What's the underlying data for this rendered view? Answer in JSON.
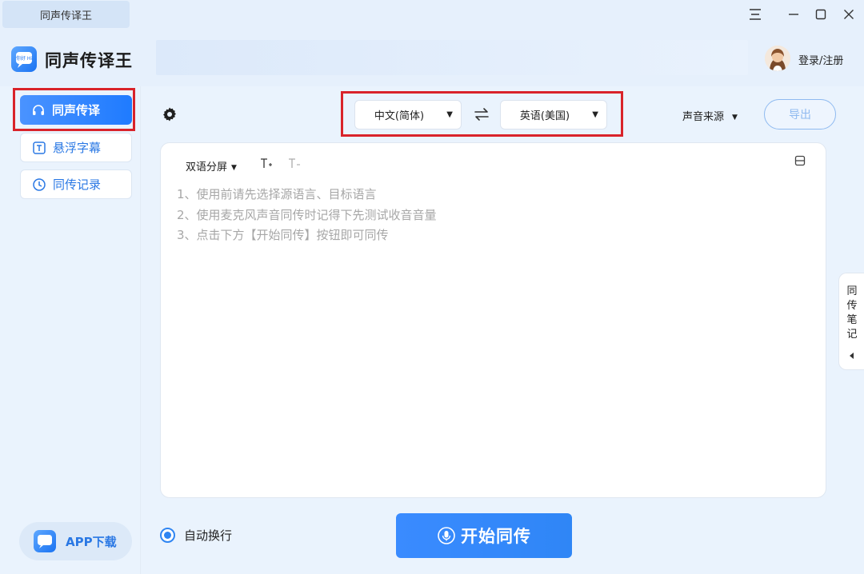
{
  "titlebar": {
    "tab_title": "同声传译王",
    "icons": [
      "menu-icon",
      "minimize-icon",
      "maximize-icon",
      "close-icon"
    ]
  },
  "header": {
    "app_name": "同声传译王",
    "logo_text": "你好 Hi",
    "login_label": "登录/注册"
  },
  "sidebar": {
    "items": [
      {
        "label": "同声传译",
        "icon": "headphones-icon",
        "active": true
      },
      {
        "label": "悬浮字幕",
        "icon": "text-box-icon",
        "active": false
      },
      {
        "label": "同传记录",
        "icon": "clock-icon",
        "active": false
      }
    ],
    "app_download_label": "APP下载"
  },
  "toolbar": {
    "source_language": "中文(简体)",
    "target_language": "英语(美国)",
    "sound_source_label": "声音来源",
    "export_label": "导出"
  },
  "panel": {
    "mode_label": "双语分屏",
    "font_increase": "T+",
    "font_decrease": "T-",
    "hints": [
      "1、使用前请先选择源语言、目标语言",
      "2、使用麦克风声音同传时记得下先测试收音音量",
      "3、点击下方【开始同传】按钮即可同传"
    ]
  },
  "notes_tab": {
    "label": "同传笔记"
  },
  "bottom": {
    "auto_wrap_label": "自动换行",
    "auto_wrap_checked": true,
    "start_label": "开始同传"
  },
  "colors": {
    "accent": "#2f85f2",
    "highlight_box": "#d9232a",
    "hint_text": "#a7a7a7",
    "background": "#eaf3fd"
  }
}
